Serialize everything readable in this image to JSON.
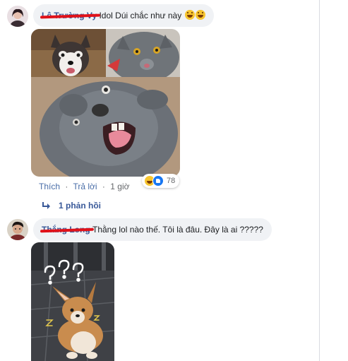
{
  "comment1": {
    "author": "Lê Trường Vy",
    "text": "Idol Dúi chắc như này",
    "emoji_icons": [
      "haha-emoji",
      "haha-emoji"
    ],
    "actions": {
      "like": "Thích",
      "reply": "Trả lời",
      "separator": "·",
      "time": "1 giờ"
    },
    "reactions": {
      "icons": [
        "haha-icon",
        "like-icon"
      ],
      "count": "78"
    },
    "replies": "1 phản hồi",
    "image": {
      "panels": [
        "husky-dog-photo",
        "grey-cat-photo",
        "grey-rodent-smiling-photo"
      ]
    }
  },
  "comment2": {
    "author": "Thắng Long",
    "text": "Thằng lol nào thế. Tôi là đâu. Đây là ai ?????",
    "image": {
      "panel": "corgi-puppy-photo",
      "overlay_marks": [
        "?",
        "?",
        "?"
      ]
    }
  },
  "colors": {
    "bubble_bg": "#f0f2f5",
    "link": "#385898",
    "meta": "#65676b",
    "redaction": "#e0121a"
  }
}
